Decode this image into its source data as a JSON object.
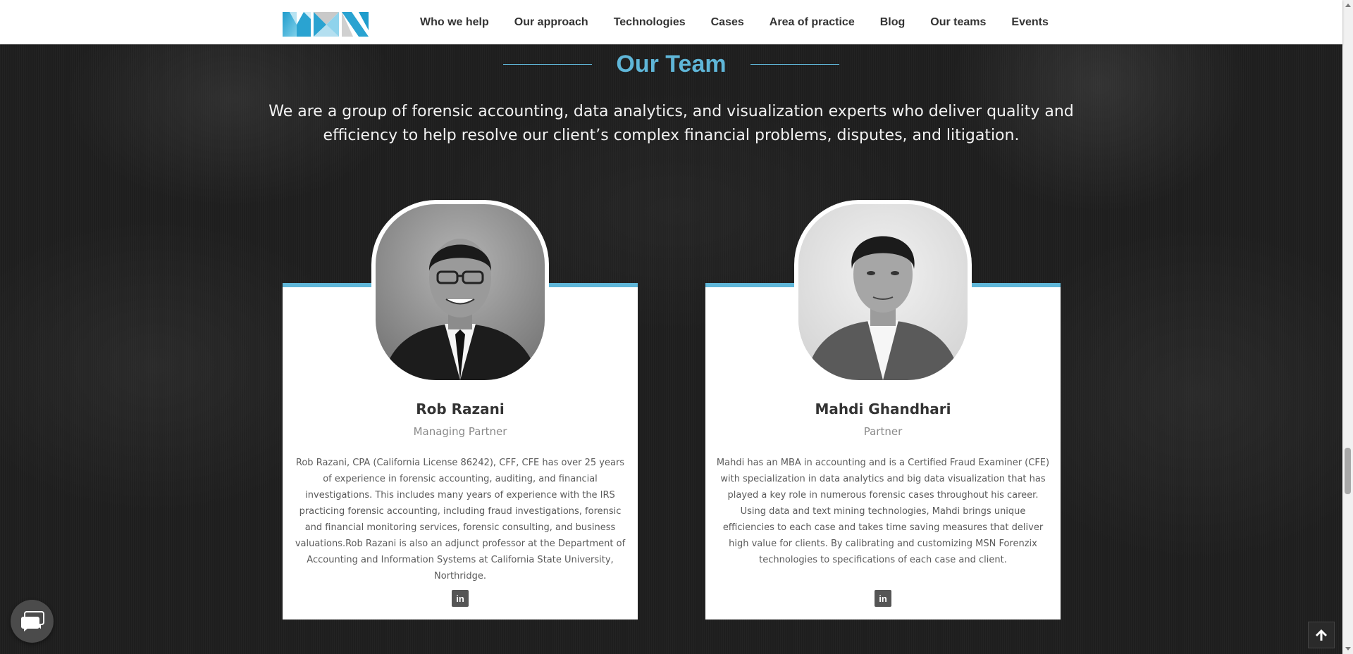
{
  "header": {
    "logo_alt": "MSN",
    "nav": [
      "Who we help",
      "Our approach",
      "Technologies",
      "Cases",
      "Area of practice",
      "Blog",
      "Our teams",
      "Events"
    ]
  },
  "section": {
    "title": "Our Team",
    "intro": "We are a group of forensic accounting, data analytics, and visualization experts who deliver quality and efficiency to help resolve our client’s complex financial problems, disputes, and litigation."
  },
  "team": [
    {
      "name": "Rob Razani",
      "role": "Managing Partner",
      "bio": "Rob Razani, CPA (California License 86242), CFF, CFE has over 25 years of experience in forensic accounting, auditing, and financial investigations. This includes many years of experience with the IRS practicing forensic accounting, including fraud investigations, forensic and financial monitoring services, forensic consulting, and business valuations.Rob Razani is also an adjunct professor at the Department of Accounting and Information Systems at California State University, Northridge.",
      "social_icon": "linkedin-icon",
      "social_label": "in"
    },
    {
      "name": "Mahdi Ghandhari",
      "role": "Partner",
      "bio": "Mahdi has an MBA in accounting and is a Certified Fraud Examiner (CFE) with specialization in data analytics and big data visualization that has played a key role in numerous forensic cases throughout his career. Using data and text mining technologies, Mahdi brings unique efficiencies to each case and takes time saving measures that deliver high value for clients. By calibrating and customizing MSN Forenzix technologies to specifications of each case and client.",
      "social_icon": "linkedin-icon",
      "social_label": "in"
    }
  ],
  "colors": {
    "accent": "#5fb6d8",
    "header_bg": "#ffffff",
    "page_bg": "#1e1e1e"
  },
  "widgets": {
    "chat_icon": "chat-bubble-icon",
    "back_to_top_icon": "arrow-up-icon"
  }
}
